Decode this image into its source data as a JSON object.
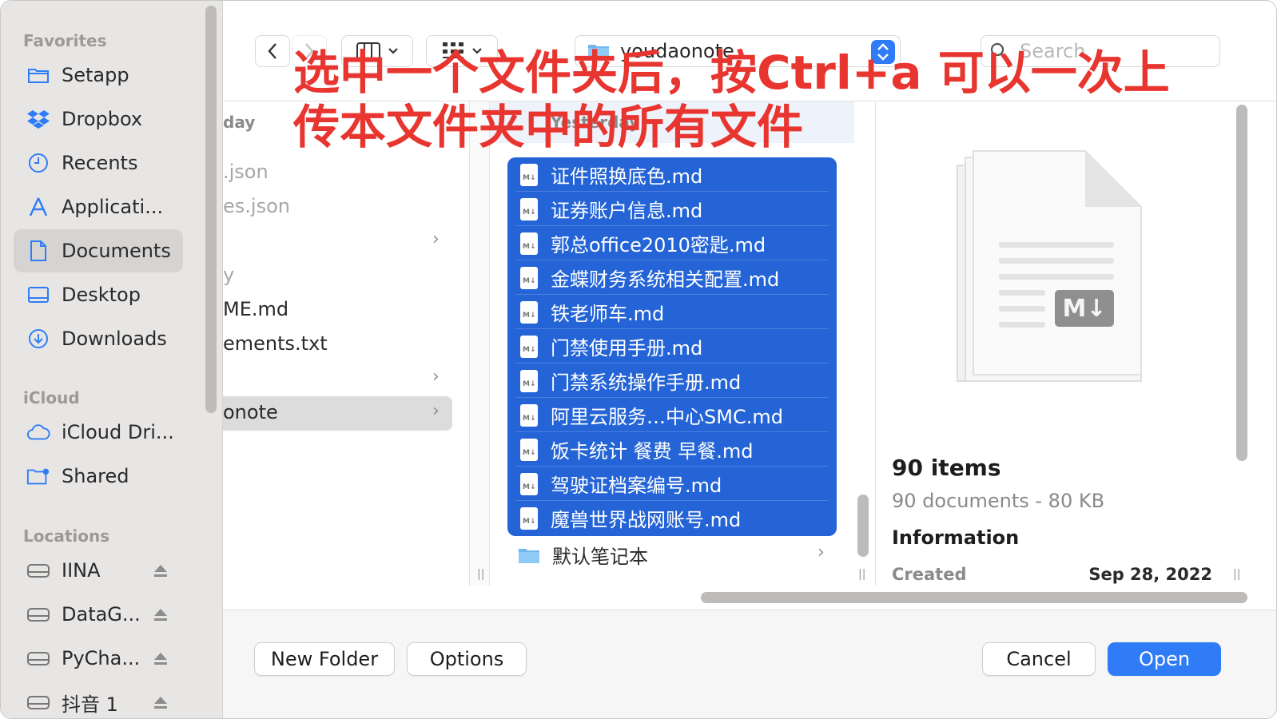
{
  "sidebar": {
    "favorites_header": "Favorites",
    "favorites": [
      {
        "label": "Setapp",
        "icon": "folder-icon"
      },
      {
        "label": "Dropbox",
        "icon": "dropbox-icon"
      },
      {
        "label": "Recents",
        "icon": "clock-icon"
      },
      {
        "label": "Applicati...",
        "icon": "applications-icon"
      },
      {
        "label": "Documents",
        "icon": "document-icon",
        "selected": true
      },
      {
        "label": "Desktop",
        "icon": "desktop-icon"
      },
      {
        "label": "Downloads",
        "icon": "download-icon"
      }
    ],
    "icloud_header": "iCloud",
    "icloud": [
      {
        "label": "iCloud Dri...",
        "icon": "cloud-icon"
      },
      {
        "label": "Shared",
        "icon": "shared-folder-icon"
      }
    ],
    "locations_header": "Locations",
    "locations": [
      {
        "label": "IINA",
        "icon": "drive-icon"
      },
      {
        "label": "DataG...",
        "icon": "drive-icon"
      },
      {
        "label": "PyCha...",
        "icon": "drive-icon"
      },
      {
        "label": "抖音 1",
        "icon": "drive-icon"
      }
    ]
  },
  "toolbar": {
    "path": "youdaonote",
    "search_placeholder": "Search"
  },
  "column1": {
    "header": "day",
    "rows": [
      {
        "label": ".json",
        "dim": true
      },
      {
        "label": "es.json",
        "dim": true
      },
      {
        "label": "",
        "chevron": true
      },
      {
        "label": "y",
        "dim": true
      },
      {
        "label": "ME.md"
      },
      {
        "label": "ements.txt"
      },
      {
        "label": "",
        "chevron": true
      },
      {
        "label": "onote",
        "chevron": true,
        "selected": true
      }
    ]
  },
  "column2": {
    "header": "Yesterday",
    "selected_files": [
      "证件照换底色.md",
      "证券账户信息.md",
      "郭总office2010密匙.md",
      "金蝶财务系统相关配置.md",
      "铁老师车.md",
      "门禁使用手册.md",
      "门禁系统操作手册.md",
      "阿里云服务…中心SMC.md",
      "饭卡统计 餐费 早餐.md",
      "驾驶证档案编号.md",
      "魔兽世界战网账号.md"
    ],
    "folder_row": "默认笔记本"
  },
  "preview": {
    "count": "90 items",
    "summary": "90 documents - 80 KB",
    "info_header": "Information",
    "created_label": "Created",
    "created_value": "Sep 28, 2022"
  },
  "buttons": {
    "new_folder": "New Folder",
    "options": "Options",
    "cancel": "Cancel",
    "open": "Open"
  },
  "annotation": "选中一个文件夹后，按Ctrl+a 可以一次上\n传本文件夹中的所有文件",
  "colors": {
    "accent": "#2f7cf6",
    "selection": "#2464d6",
    "annotation": "#e8352f"
  }
}
